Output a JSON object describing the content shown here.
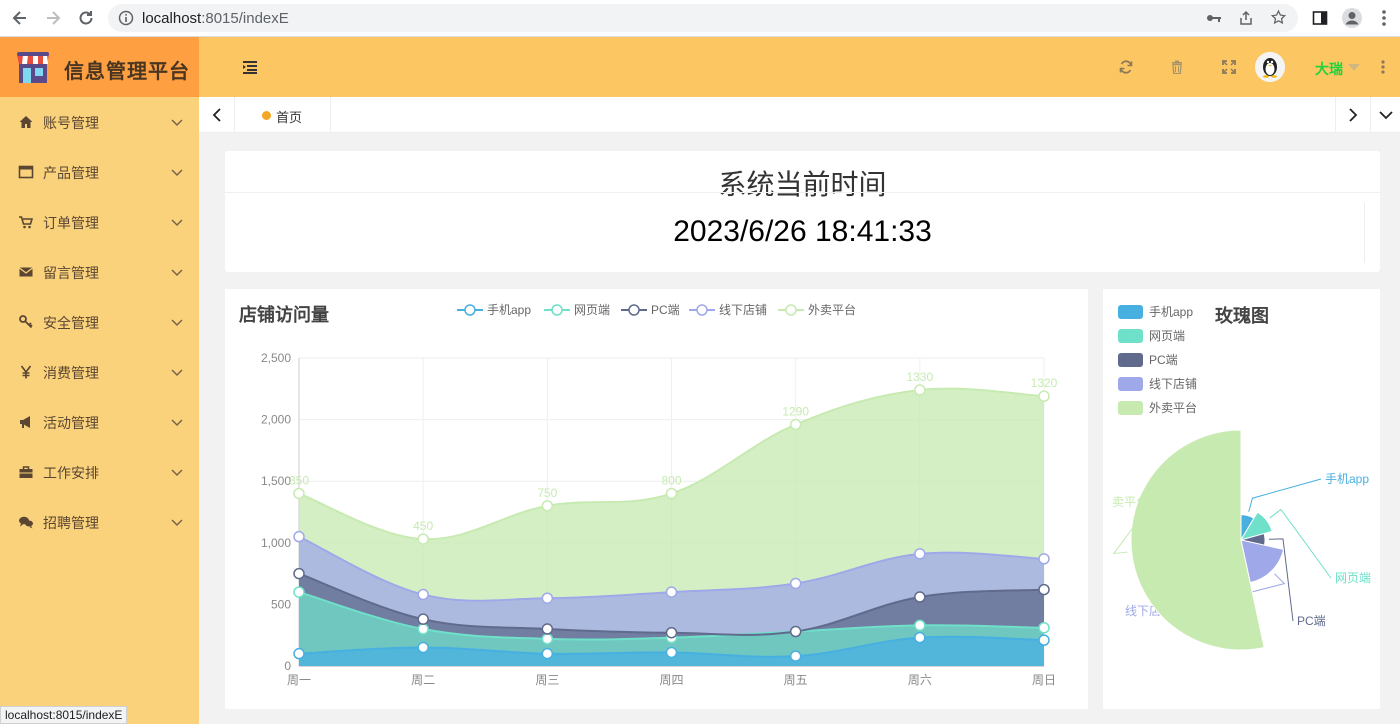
{
  "browser": {
    "url_host": "localhost",
    "url_rest": ":8015/indexE",
    "status_text": "localhost:8015/indexE"
  },
  "app": {
    "title": "信息管理平台",
    "username": "大瑞",
    "colors": {
      "sidebar": "#fbd27c",
      "header": "#fcc662",
      "logo_bar": "#fea042",
      "username": "#1fd33b"
    }
  },
  "sidebar": {
    "items": [
      {
        "label": "账号管理",
        "icon": "home-icon"
      },
      {
        "label": "产品管理",
        "icon": "window-icon"
      },
      {
        "label": "订单管理",
        "icon": "cart-icon"
      },
      {
        "label": "留言管理",
        "icon": "envelope-icon"
      },
      {
        "label": "安全管理",
        "icon": "key-icon"
      },
      {
        "label": "消费管理",
        "icon": "yen-icon"
      },
      {
        "label": "活动管理",
        "icon": "bullhorn-icon"
      },
      {
        "label": "工作安排",
        "icon": "briefcase-icon"
      },
      {
        "label": "招聘管理",
        "icon": "comments-icon"
      }
    ]
  },
  "tabs": [
    {
      "label": "首页"
    }
  ],
  "time_card": {
    "title": "系统当前时间",
    "value": "2023/6/26 18:41:33"
  },
  "visits_chart_title": "店铺访问量",
  "rose_chart_title": "玫瑰图",
  "chart_data": [
    {
      "type": "area",
      "stacked": true,
      "categories": [
        "周一",
        "周二",
        "周三",
        "周四",
        "周五",
        "周六",
        "周日"
      ],
      "ylim": [
        0,
        2500
      ],
      "yticks": [
        "0",
        "500",
        "1,000",
        "1,500",
        "2,000",
        "2,500"
      ],
      "legend_position": "top",
      "series": [
        {
          "name": "手机app",
          "color": "#47b0e1",
          "values": [
            100,
            150,
            100,
            110,
            80,
            230,
            210
          ]
        },
        {
          "name": "网页端",
          "color": "#6fe0c9",
          "values": [
            500,
            150,
            120,
            120,
            200,
            100,
            100
          ]
        },
        {
          "name": "PC端",
          "color": "#5f6a8c",
          "values": [
            150,
            80,
            80,
            40,
            0,
            230,
            310
          ]
        },
        {
          "name": "线下店铺",
          "color": "#9fa8e8",
          "values": [
            300,
            200,
            250,
            330,
            390,
            350,
            250
          ]
        },
        {
          "name": "外卖平台",
          "color": "#c7eab1",
          "values": [
            350,
            450,
            750,
            800,
            1290,
            1330,
            1320
          ]
        }
      ],
      "top_labels": [
        "350",
        "450",
        "750",
        "800",
        "1290",
        "1330",
        "1320"
      ]
    },
    {
      "type": "pie",
      "variant": "rose",
      "legend_position": "top-left",
      "series": [
        {
          "name": "手机app",
          "color": "#47b0e1",
          "value": 970
        },
        {
          "name": "网页端",
          "color": "#6fe0c9",
          "value": 1390
        },
        {
          "name": "PC端",
          "color": "#5f6a8c",
          "value": 890
        },
        {
          "name": "线下店铺",
          "color": "#9fa8e8",
          "value": 2070
        },
        {
          "name": "外卖平台",
          "color": "#c7eab1",
          "value": 6090
        }
      ],
      "slice_labels": [
        "手机app",
        "网页端",
        "PC端",
        "线下店铺",
        "卖平台"
      ]
    }
  ]
}
